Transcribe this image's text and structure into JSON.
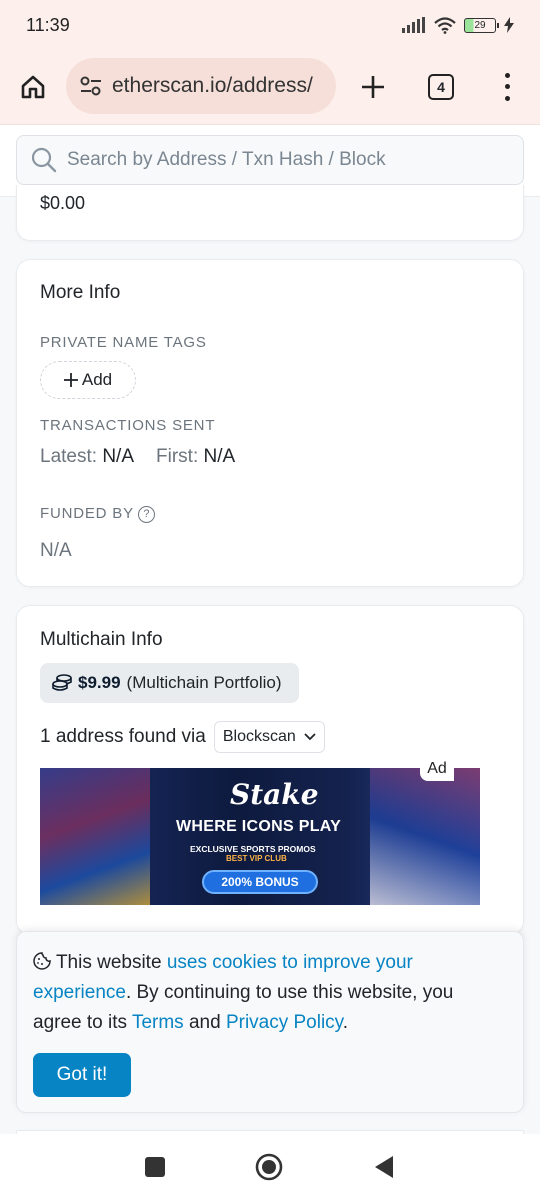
{
  "status_bar": {
    "time": "11:39",
    "battery": "29"
  },
  "browser": {
    "url": "etherscan.io/address/",
    "tab_count": "4"
  },
  "search": {
    "placeholder": "Search by Address / Txn Hash / Block"
  },
  "balance_card": {
    "value": "$0.00"
  },
  "more_info": {
    "title": "More Info",
    "private_name_tags_label": "PRIVATE NAME TAGS",
    "add_label": "Add",
    "transactions_sent_label": "TRANSACTIONS SENT",
    "latest_label": "Latest:",
    "latest_value": "N/A",
    "first_label": "First:",
    "first_value": "N/A",
    "funded_by_label": "FUNDED BY",
    "funded_by_value": "N/A"
  },
  "multichain": {
    "title": "Multichain Info",
    "portfolio_value": "$9.99",
    "portfolio_label": "(Multichain Portfolio)",
    "address_found_text": "1 address found via",
    "blockscan_label": "Blockscan"
  },
  "ad": {
    "tag": "Ad",
    "brand": "Stake",
    "headline": "WHERE ICONS PLAY",
    "subline": "EXCLUSIVE SPORTS PROMOS",
    "subline2": "BEST VIP CLUB",
    "bonus": "200% BONUS"
  },
  "cookie": {
    "text_1": "This website",
    "link_1": "uses cookies to improve your experience",
    "text_2": ". By continuing to use this website, you agree to its",
    "link_terms": "Terms",
    "text_3": "and",
    "link_privacy": "Privacy Policy",
    "text_4": ".",
    "button": "Got it!"
  },
  "colors": {
    "accent": "#0784c3",
    "chrome_bg": "#fdf0ec",
    "url_bg": "#f6dfd9"
  }
}
